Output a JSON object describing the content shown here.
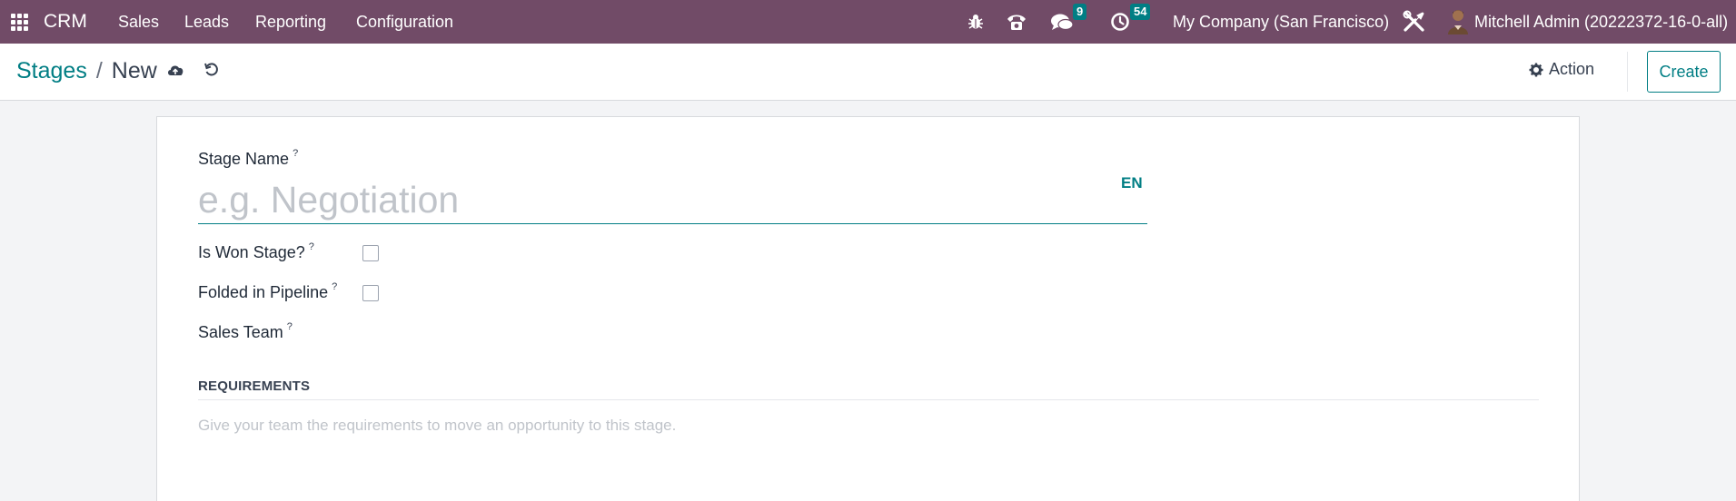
{
  "navbar": {
    "app_name": "CRM",
    "menu": [
      "Sales",
      "Leads",
      "Reporting",
      "Configuration"
    ],
    "messages_count": "9",
    "activities_count": "54",
    "company": "My Company (San Francisco)",
    "user": "Mitchell Admin (20222372-16-0-all)",
    "icons": [
      "apps-grid-icon",
      "bug-icon",
      "phone-icon",
      "chat-icon",
      "clock-icon",
      "tools-icon"
    ]
  },
  "control_panel": {
    "breadcrumb_parent": "Stages",
    "breadcrumb_separator": "/",
    "breadcrumb_current": "New",
    "action_label": "Action",
    "create_label": "Create"
  },
  "form": {
    "stage_name_label": "Stage Name",
    "stage_name_value": "",
    "stage_name_placeholder": "e.g. Negotiation",
    "lang_label": "EN",
    "help_marker": "?",
    "is_won_label": "Is Won Stage?",
    "is_won_checked": false,
    "folded_label": "Folded in Pipeline",
    "folded_checked": false,
    "sales_team_label": "Sales Team",
    "requirements_title": "REQUIREMENTS",
    "requirements_placeholder": "Give your team the requirements to move an opportunity to this stage."
  },
  "colors": {
    "navbar_bg": "#714b67",
    "accent": "#017e84",
    "page_bg": "#f3f4f6"
  }
}
